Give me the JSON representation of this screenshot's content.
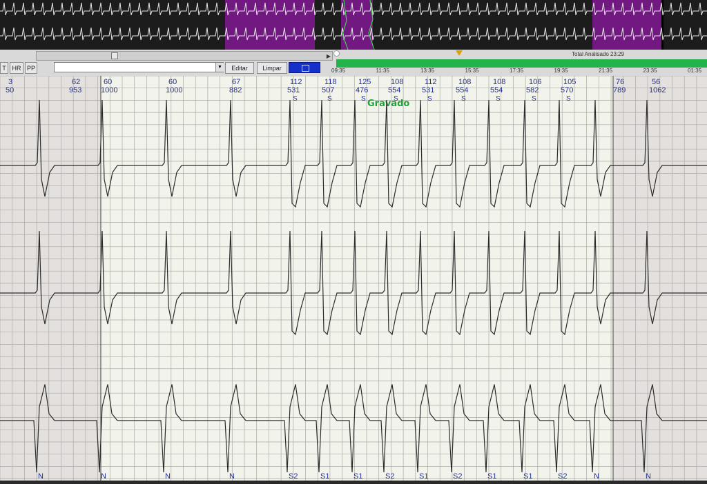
{
  "toolbar": {
    "buttons": [
      "T",
      "HR",
      "PP"
    ],
    "edit_label": "Editar",
    "clear_label": "Limpar",
    "note_value": ""
  },
  "timeline": {
    "total_label": "Total Analisado 23:29",
    "ticks": [
      "09:35",
      "11:35",
      "13:35",
      "15:35",
      "17:35",
      "19:35",
      "21:35",
      "23:35",
      "01:35"
    ]
  },
  "recording": {
    "status_label": "Gravado"
  },
  "beats": [
    {
      "hr": "3",
      "rr": "50",
      "s": false,
      "label": "N"
    },
    {
      "hr": "62",
      "rr": "953",
      "s": false,
      "label": "N"
    },
    {
      "hr": "60",
      "rr": "1000",
      "s": false,
      "label": "N"
    },
    {
      "hr": "60",
      "rr": "1000",
      "s": false,
      "label": "N"
    },
    {
      "hr": "67",
      "rr": "882",
      "s": false,
      "label": "N"
    },
    {
      "hr": "112",
      "rr": "531",
      "s": true,
      "label": "S2"
    },
    {
      "hr": "118",
      "rr": "507",
      "s": true,
      "label": "S1"
    },
    {
      "hr": "125",
      "rr": "476",
      "s": true,
      "label": "S1"
    },
    {
      "hr": "108",
      "rr": "554",
      "s": true,
      "label": "S2"
    },
    {
      "hr": "112",
      "rr": "531",
      "s": true,
      "label": "S1"
    },
    {
      "hr": "108",
      "rr": "554",
      "s": true,
      "label": "S2"
    },
    {
      "hr": "108",
      "rr": "554",
      "s": true,
      "label": "S1"
    },
    {
      "hr": "106",
      "rr": "582",
      "s": true,
      "label": "S1"
    },
    {
      "hr": "105",
      "rr": "570",
      "s": true,
      "label": "S2"
    },
    {
      "hr": "76",
      "rr": "789",
      "s": false,
      "label": "N"
    },
    {
      "hr": "56",
      "rr": "1062",
      "s": false,
      "label": "N"
    }
  ],
  "colors": {
    "grid_bg": "#f2f3ea",
    "grid_line": "#a9aaa6",
    "trace": "#2b2b2b",
    "label_blue": "#1f2fa0",
    "recorded_green": "#22a23a",
    "timeline_green": "#22b34a",
    "selection_purple": "#7b1a8c"
  }
}
